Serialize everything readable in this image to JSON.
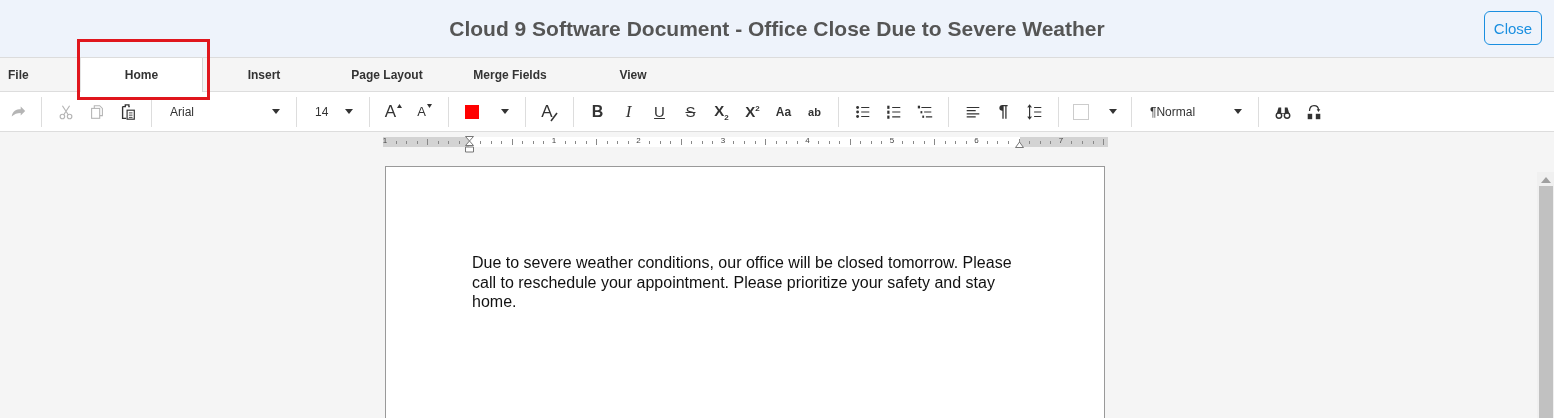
{
  "header": {
    "title": "Cloud 9 Software Document - Office Close Due to Severe Weather",
    "close_button": "Close"
  },
  "tabs": [
    {
      "label": "File",
      "selected": false,
      "highlighted": false
    },
    {
      "label": "Home",
      "selected": true,
      "highlighted": true
    },
    {
      "label": "Insert",
      "selected": false,
      "highlighted": false
    },
    {
      "label": "Page Layout",
      "selected": false,
      "highlighted": false
    },
    {
      "label": "Merge Fields",
      "selected": false,
      "highlighted": false
    },
    {
      "label": "View",
      "selected": false,
      "highlighted": false
    }
  ],
  "toolbar": {
    "groups": [
      [
        {
          "kind": "redo",
          "disabled": true
        }
      ],
      [
        {
          "kind": "cut",
          "disabled": true
        },
        {
          "kind": "copy",
          "disabled": true
        },
        {
          "kind": "paste",
          "disabled": false
        }
      ],
      [
        {
          "kind": "font-dropdown",
          "value": "Arial"
        }
      ],
      [
        {
          "kind": "size-dropdown",
          "value": "14"
        }
      ],
      [
        {
          "kind": "grow-font",
          "text": "A"
        },
        {
          "kind": "shrink-font",
          "text": "A"
        }
      ],
      [
        {
          "kind": "font-color",
          "color": "#ff0000"
        }
      ],
      [
        {
          "kind": "clear-format",
          "text": "A"
        }
      ],
      [
        {
          "kind": "bold",
          "text": "B"
        },
        {
          "kind": "italic",
          "text": "I"
        },
        {
          "kind": "underline",
          "text": "U"
        },
        {
          "kind": "strikethrough",
          "text": "S"
        },
        {
          "kind": "subscript",
          "text": "X$_{2}$"
        },
        {
          "kind": "superscript",
          "text": "X$^{2}$"
        },
        {
          "kind": "change-case",
          "text": "Aa"
        },
        {
          "kind": "highlight",
          "text": "ab"
        }
      ],
      [
        {
          "kind": "bullets"
        },
        {
          "kind": "numbering"
        },
        {
          "kind": "multilevel"
        }
      ],
      [
        {
          "kind": "align-left"
        },
        {
          "kind": "paragraph",
          "text": "¶"
        },
        {
          "kind": "line-spacing"
        }
      ],
      [
        {
          "kind": "shading"
        }
      ],
      [
        {
          "kind": "style-dropdown",
          "value": "¶Normal"
        }
      ],
      [
        {
          "kind": "find"
        },
        {
          "kind": "replace"
        }
      ]
    ]
  },
  "ruler": {
    "labels": [
      "1",
      "1",
      "2",
      "3",
      "4",
      "5",
      "6",
      "7"
    ]
  },
  "document": {
    "paragraph": "Due to severe weather conditions, our office will be closed tomorrow. Please call to reschedule your appointment. Please prioritize your safety and stay home."
  }
}
